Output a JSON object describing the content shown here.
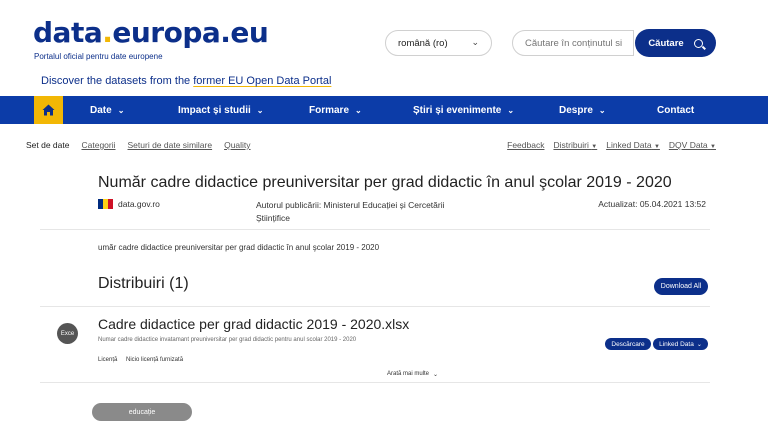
{
  "header": {
    "logo_main": "data",
    "logo_dot": ".",
    "logo_rest": "europa.eu",
    "tagline": "Portalul oficial pentru date europene",
    "language": "română (ro)",
    "search_placeholder": "Căutare în conținutul si",
    "search_button": "Căutare"
  },
  "discover": {
    "prefix": "Discover the datasets from the ",
    "link": "former EU Open Data Portal"
  },
  "nav": {
    "items": [
      {
        "label": "Date"
      },
      {
        "label": "Impact și studii"
      },
      {
        "label": "Formare"
      },
      {
        "label": "Știri și evenimente"
      },
      {
        "label": "Despre"
      },
      {
        "label": "Contact"
      }
    ]
  },
  "subnav": {
    "left": [
      "Set de date",
      "Categorii",
      "Seturi de date similare",
      "Quality"
    ],
    "right": [
      "Feedback",
      "Distribuiri",
      "Linked Data",
      "DQV Data"
    ]
  },
  "dataset": {
    "title": "Număr cadre didactice preuniversitar per grad didactic în anul şcolar 2019 - 2020",
    "publisher_site": "data.gov.ro",
    "author": "Autorul publicării: Ministerul Educației și Cercetării Științifice",
    "updated": "Actualizat: 05.04.2021 13:52",
    "description": "umăr cadre didactice preuniversitar per grad didactic în anul şcolar 2019 - 2020",
    "flag_colors": [
      "#002b7f",
      "#fcd116",
      "#ce1126"
    ]
  },
  "distributions": {
    "title": "Distribuiri (1)",
    "download_all": "Download All",
    "items": [
      {
        "format": "Exce",
        "title": "Cadre didactice per grad didactic 2019 - 2020.xlsx",
        "description": "Numar cadre didactice invatamant preuniversitar per grad didactic pentru anul scolar 2019 - 2020",
        "download": "Descărcare",
        "linked_data": "Linked Data",
        "licence_label": "Licență",
        "licence_value": "Niciо licență furnizată",
        "show_more": "Arată mai multe"
      }
    ]
  },
  "tags": [
    "educație"
  ],
  "colors": {
    "primary": "#0c2f8a",
    "nav_bg": "#0c3ca8",
    "accent": "#f2b705"
  }
}
